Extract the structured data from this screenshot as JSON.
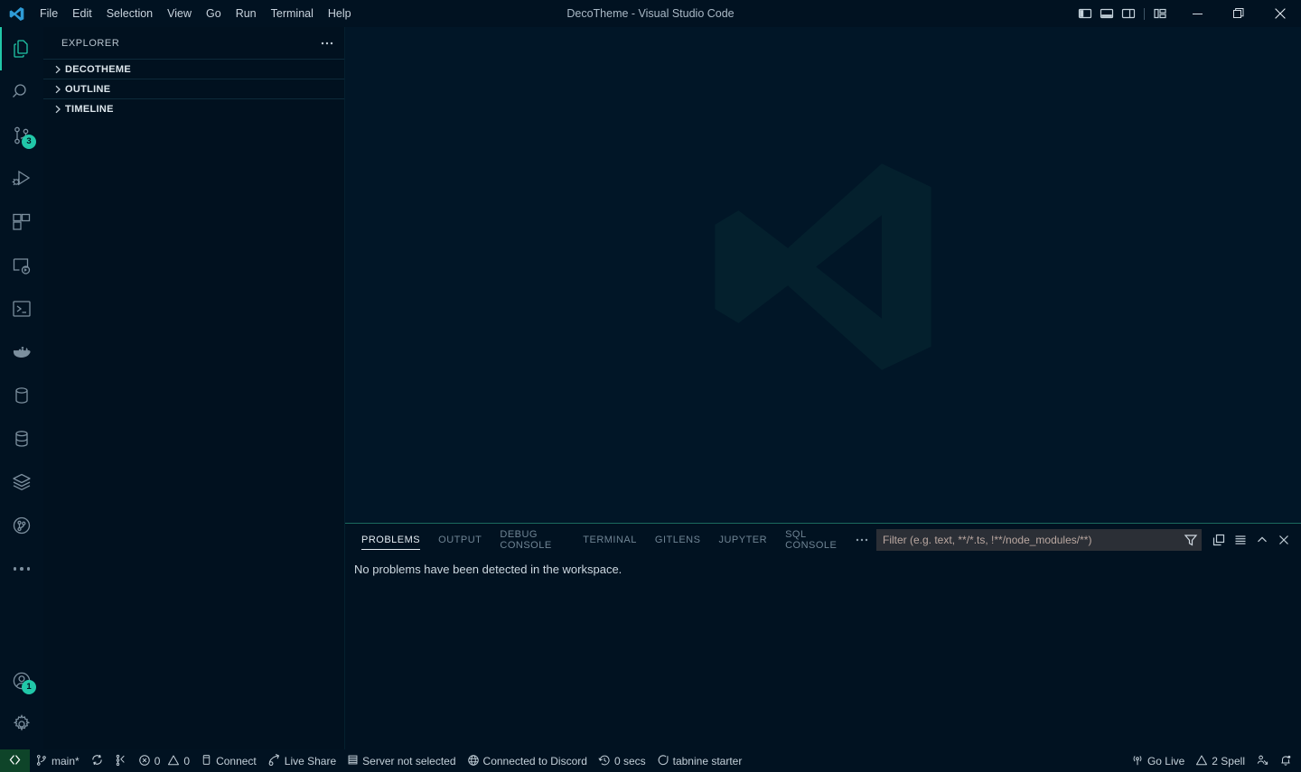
{
  "window": {
    "title": "DecoTheme - Visual Studio Code",
    "logo_icon": "vscode-logo-icon",
    "controls": [
      {
        "name": "minimize-button",
        "icon": "minimize-icon",
        "label": "Minimize"
      },
      {
        "name": "restore-button",
        "icon": "restore-icon",
        "label": "Restore"
      },
      {
        "name": "close-button",
        "icon": "close-icon",
        "label": "Close"
      }
    ],
    "layout_controls": [
      {
        "name": "toggle-primary-sidebar-button",
        "icon": "layout-sidebar-left-icon"
      },
      {
        "name": "toggle-panel-button",
        "icon": "layout-panel-icon"
      },
      {
        "name": "toggle-secondary-sidebar-button",
        "icon": "layout-sidebar-right-icon"
      },
      {
        "name": "customize-layout-button",
        "icon": "layout-grid-icon"
      }
    ]
  },
  "menubar": {
    "items": [
      {
        "label": "File"
      },
      {
        "label": "Edit"
      },
      {
        "label": "Selection"
      },
      {
        "label": "View"
      },
      {
        "label": "Go"
      },
      {
        "label": "Run"
      },
      {
        "label": "Terminal"
      },
      {
        "label": "Help"
      }
    ]
  },
  "activitybar": {
    "top_items": [
      {
        "name": "activity-explorer",
        "icon": "files-icon",
        "active": true,
        "badge": ""
      },
      {
        "name": "activity-search",
        "icon": "search-icon",
        "active": false,
        "badge": ""
      },
      {
        "name": "activity-source-control",
        "icon": "source-control-icon",
        "active": false,
        "badge": "3"
      },
      {
        "name": "activity-run-debug",
        "icon": "run-and-debug-icon",
        "active": false,
        "badge": ""
      },
      {
        "name": "activity-extensions",
        "icon": "extensions-icon",
        "active": false,
        "badge": ""
      },
      {
        "name": "activity-remote-explorer",
        "icon": "remote-explorer-icon",
        "active": false,
        "badge": ""
      },
      {
        "name": "activity-terminal-view",
        "icon": "terminal-icon",
        "active": false,
        "badge": ""
      },
      {
        "name": "activity-docker",
        "icon": "docker-whale-icon",
        "active": false,
        "badge": ""
      },
      {
        "name": "activity-database-client",
        "icon": "database-cylinder-icon",
        "active": false,
        "badge": ""
      },
      {
        "name": "activity-sql-server",
        "icon": "database-stack-icon",
        "active": false,
        "badge": ""
      },
      {
        "name": "activity-layers",
        "icon": "layers-icon",
        "active": false,
        "badge": ""
      },
      {
        "name": "activity-git-graph",
        "icon": "git-graph-circle-icon",
        "active": false,
        "badge": ""
      },
      {
        "name": "activity-additional-views",
        "icon": "more-dots-icon",
        "active": false,
        "badge": ""
      }
    ],
    "bottom_items": [
      {
        "name": "activity-accounts",
        "icon": "account-icon",
        "badge": "1"
      },
      {
        "name": "activity-manage-settings",
        "icon": "gear-icon",
        "badge": ""
      }
    ]
  },
  "sidebar": {
    "title": "EXPLORER",
    "more_actions_icon": "ellipsis-icon",
    "sections": [
      {
        "name": "explorer-section-decotheme",
        "label": "DECOTHEME",
        "expanded": false,
        "chevron": "chevron-right-icon"
      },
      {
        "name": "explorer-section-outline",
        "label": "OUTLINE",
        "expanded": false,
        "chevron": "chevron-right-icon"
      },
      {
        "name": "explorer-section-timeline",
        "label": "TIMELINE",
        "expanded": false,
        "chevron": "chevron-right-icon"
      }
    ]
  },
  "editor": {
    "watermark_icon": "vscode-logo-watermark"
  },
  "panel": {
    "tabs": [
      {
        "name": "panel-tab-problems",
        "label": "PROBLEMS",
        "active": true
      },
      {
        "name": "panel-tab-output",
        "label": "OUTPUT",
        "active": false
      },
      {
        "name": "panel-tab-debug-console",
        "label": "DEBUG CONSOLE",
        "active": false
      },
      {
        "name": "panel-tab-terminal",
        "label": "TERMINAL",
        "active": false
      },
      {
        "name": "panel-tab-gitlens",
        "label": "GITLENS",
        "active": false
      },
      {
        "name": "panel-tab-jupyter",
        "label": "JUPYTER",
        "active": false
      },
      {
        "name": "panel-tab-sql-console",
        "label": "SQL CONSOLE",
        "active": false
      }
    ],
    "more_tabs_icon": "ellipsis-icon",
    "filter": {
      "placeholder": "Filter (e.g. text, **/*.ts, !**/node_modules/**)",
      "value": "",
      "filter_icon": "funnel-icon"
    },
    "actions": [
      {
        "name": "collapse-all-button",
        "icon": "collapse-all-icon"
      },
      {
        "name": "view-as-list-button",
        "icon": "list-icon"
      },
      {
        "name": "maximize-panel-button",
        "icon": "chevron-up-icon"
      },
      {
        "name": "close-panel-button",
        "icon": "close-icon"
      }
    ],
    "message": "No problems have been detected in the workspace."
  },
  "statusbar": {
    "left": [
      {
        "name": "status-remote-host",
        "icon": "remote-icon",
        "label": "",
        "remote": true
      },
      {
        "name": "status-branch",
        "icon": "git-branch-icon",
        "label": "main*"
      },
      {
        "name": "status-sync",
        "icon": "sync-icon",
        "label": ""
      },
      {
        "name": "status-gitlens-compare",
        "icon": "gitlens-icon",
        "label": ""
      },
      {
        "name": "status-problems",
        "icon": "error-warning-icons",
        "label": "0  0",
        "errors": "0",
        "warnings": "0"
      },
      {
        "name": "status-connect",
        "icon": "database-icon",
        "label": "Connect"
      },
      {
        "name": "status-live-share",
        "icon": "live-share-icon",
        "label": "Live Share"
      },
      {
        "name": "status-sql-server",
        "icon": "server-icon",
        "label": "Server not selected"
      },
      {
        "name": "status-discord",
        "icon": "globe-icon",
        "label": "Connected to Discord"
      },
      {
        "name": "status-wakatime",
        "icon": "history-icon",
        "label": "0 secs"
      },
      {
        "name": "status-tabnine",
        "icon": "tabnine-icon",
        "label": "tabnine starter"
      }
    ],
    "right": [
      {
        "name": "status-go-live",
        "icon": "broadcast-icon",
        "label": "Go Live"
      },
      {
        "name": "status-spell-checker",
        "icon": "warning-triangle-icon",
        "label": "2 Spell"
      },
      {
        "name": "status-feedback",
        "icon": "feedback-icon",
        "label": ""
      },
      {
        "name": "status-notifications",
        "icon": "bell-dot-icon",
        "label": ""
      }
    ]
  },
  "colors": {
    "accent": "#21c7a8",
    "background": "#011627",
    "chrome": "#011221",
    "sidebar": "#01111f",
    "remote_green": "#0e4429",
    "text": "#c3cfd8"
  }
}
